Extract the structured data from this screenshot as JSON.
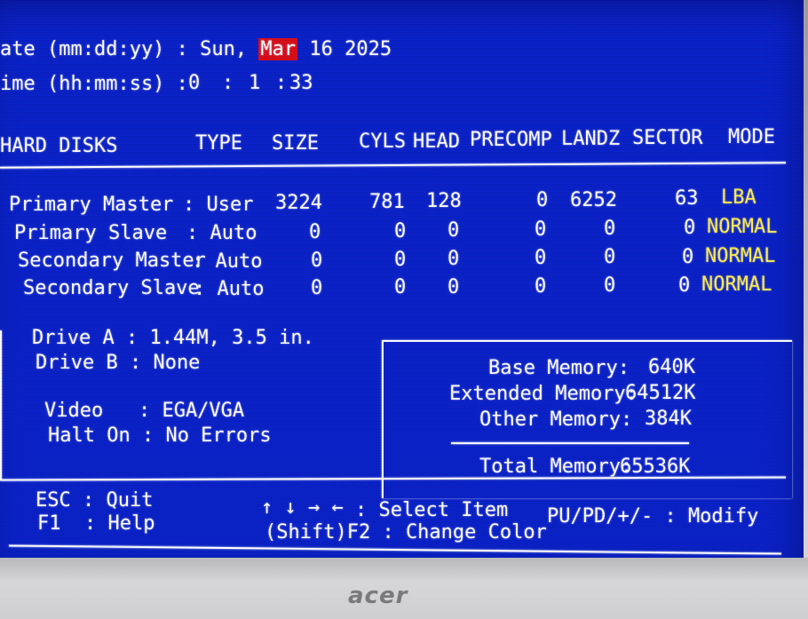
{
  "datetime": {
    "date_label": "ate (mm:dd:yy) : Sun, ",
    "date_month": "Mar",
    "date_rest": " 16 2025",
    "time_label": "ime (hh:mm:ss) :",
    "time_h": "0",
    "time_sep1": ":",
    "time_m": "1",
    "time_sep2": ":",
    "time_s": "33"
  },
  "table": {
    "headers": [
      "HARD DISKS",
      "TYPE",
      "SIZE",
      "CYLS",
      "HEAD",
      "PRECOMP",
      "LANDZ",
      "SECTOR",
      "MODE"
    ],
    "rows": [
      {
        "name": "Primary Master",
        "type": ": User",
        "size": "3224",
        "cyls": "781",
        "head": "128",
        "precomp": "0",
        "landz": "6252",
        "sector": "63",
        "mode": "LBA"
      },
      {
        "name": "Primary Slave",
        "type": ": Auto",
        "size": "0",
        "cyls": "0",
        "head": "0",
        "precomp": "0",
        "landz": "0",
        "sector": "0",
        "mode": "NORMAL"
      },
      {
        "name": "Secondary Master",
        "type": ": Auto",
        "size": "0",
        "cyls": "0",
        "head": "0",
        "precomp": "0",
        "landz": "0",
        "sector": "0",
        "mode": "NORMAL"
      },
      {
        "name": "Secondary Slave",
        "type": ": Auto",
        "size": "0",
        "cyls": "0",
        "head": "0",
        "precomp": "0",
        "landz": "0",
        "sector": "0",
        "mode": "NORMAL"
      }
    ]
  },
  "drives": {
    "drive_a": "Drive A : 1.44M, 3.5 in.",
    "drive_b": "Drive B : None",
    "video": "Video   : EGA/VGA",
    "halt_on": "Halt On : No Errors"
  },
  "memory": {
    "base_label": "Base Memory:",
    "base_value": "640K",
    "ext_label": "Extended Memory:",
    "ext_value": "64512K",
    "other_label": "Other Memory:",
    "other_value": "384K",
    "total_label": "Total Memory:",
    "total_value": "65536K"
  },
  "footer": {
    "esc": "ESC : Quit",
    "f1": "F1  : Help",
    "arrows": "↑ ↓ → ←",
    "select": ": Select Item",
    "shiftf2": "(Shift)F2 : Change Color",
    "modify": "PU/PD/+/- : Modify"
  },
  "monitor": {
    "brand": "acer"
  },
  "colors": {
    "background": "#0b22c8",
    "text": "#ffffff",
    "value_highlight": "#ffee55",
    "selection": "#d80e1a"
  }
}
